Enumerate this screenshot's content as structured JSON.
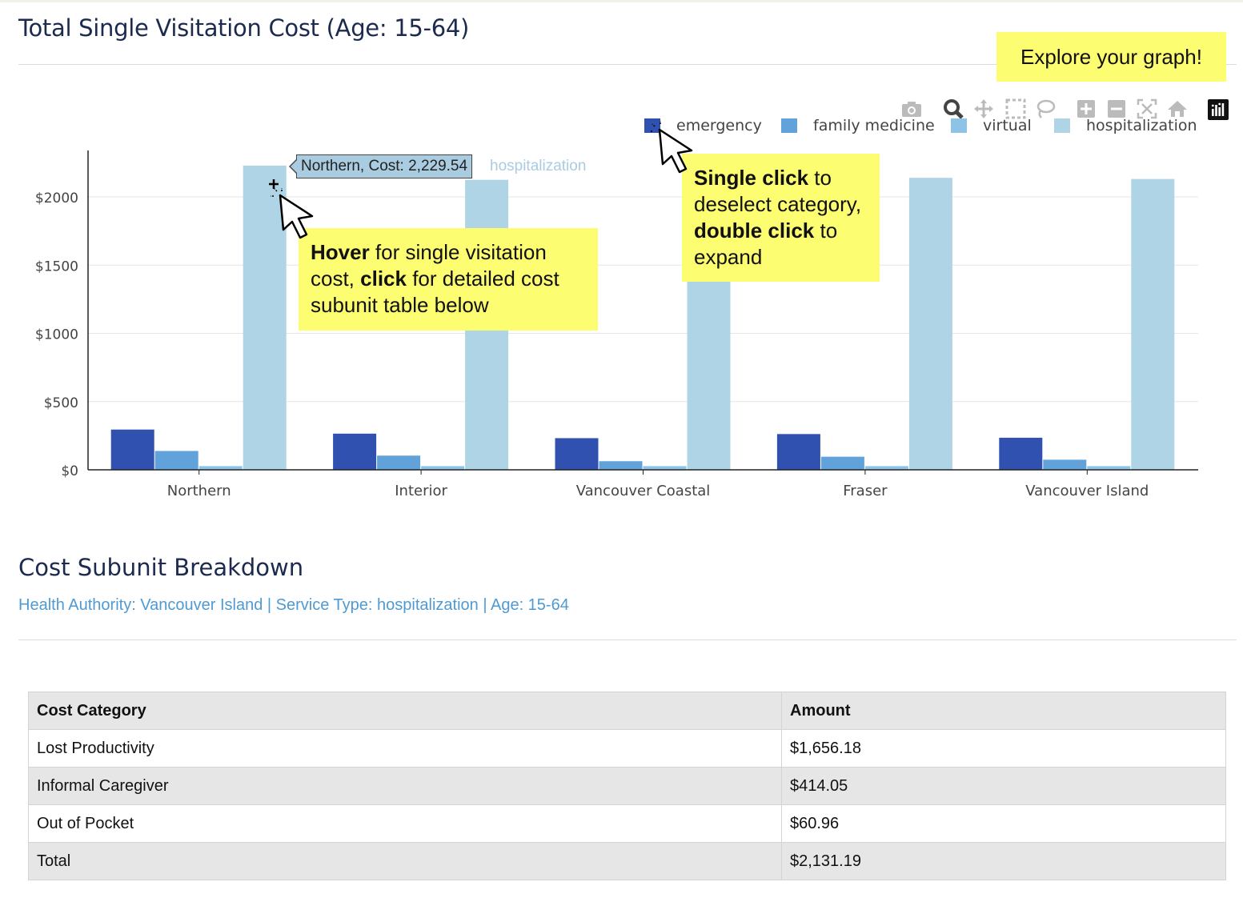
{
  "page": {
    "title": "Total Single Visitation Cost (Age: 15-64)",
    "explore_note": "Explore your graph!"
  },
  "modebar": {
    "icons": [
      "camera-icon",
      "zoom-icon",
      "pan-icon",
      "box-select-icon",
      "lasso-select-icon",
      "zoom-in-icon",
      "zoom-out-icon",
      "autoscale-icon",
      "reset-axes-icon",
      "plotly-logo-icon"
    ]
  },
  "tooltip": {
    "text": "Northern, Cost: 2,229.54",
    "series": "hospitalization"
  },
  "callouts": {
    "hover": {
      "parts": [
        {
          "text": "Hover",
          "bold": true
        },
        {
          "text": " for single visitation cost, ",
          "bold": false
        },
        {
          "text": "click",
          "bold": true
        },
        {
          "text": " for detailed cost subunit table below",
          "bold": false
        }
      ]
    },
    "legend": {
      "parts": [
        {
          "text": "Single click",
          "bold": true
        },
        {
          "text": " to deselect category, ",
          "bold": false
        },
        {
          "text": "double click",
          "bold": true
        },
        {
          "text": " to expand",
          "bold": false
        }
      ]
    }
  },
  "chart_data": {
    "type": "bar",
    "categories": [
      "Northern",
      "Interior",
      "Vancouver Coastal",
      "Fraser",
      "Vancouver Island"
    ],
    "series": [
      {
        "name": "emergency",
        "color": "#3051b0",
        "values": [
          295,
          265,
          232,
          262,
          235
        ]
      },
      {
        "name": "family medicine",
        "color": "#62a2db",
        "values": [
          138,
          104,
          63,
          96,
          74
        ]
      },
      {
        "name": "virtual",
        "color": "#8ec3e8",
        "values": [
          27,
          27,
          27,
          27,
          27
        ]
      },
      {
        "name": "hospitalization",
        "color": "#aed4e6",
        "values": [
          2229.54,
          2125,
          1640,
          2140,
          2131.19
        ]
      }
    ],
    "ylim": [
      0,
      2300
    ],
    "yticks": [
      0,
      500,
      1000,
      1500,
      2000
    ],
    "ytick_labels": [
      "$0",
      "$500",
      "$1000",
      "$1500",
      "$2000"
    ],
    "grid": true,
    "legend_position": "top-right",
    "xlabel": "",
    "ylabel": ""
  },
  "breakdown": {
    "title": "Cost Subunit Breakdown",
    "filter": "Health Authority: Vancouver Island | Service Type: hospitalization | Age: 15-64",
    "columns": [
      "Cost Category",
      "Amount"
    ],
    "rows": [
      {
        "category": "Lost Productivity",
        "amount": "$1,656.18"
      },
      {
        "category": "Informal Caregiver",
        "amount": "$414.05"
      },
      {
        "category": "Out of Pocket",
        "amount": "$60.96"
      },
      {
        "category": "Total",
        "amount": "$2,131.19"
      }
    ]
  }
}
